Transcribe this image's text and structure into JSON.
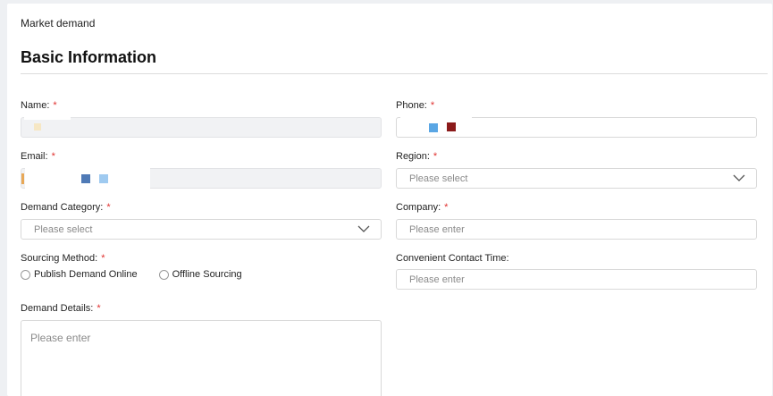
{
  "breadcrumb": "Market demand",
  "section_title": "Basic Information",
  "required_mark": "*",
  "form": {
    "name_label": "Name:",
    "phone_label": "Phone:",
    "email_label": "Email:",
    "region_label": "Region:",
    "region_placeholder": "Please select",
    "demand_category_label": "Demand Category:",
    "demand_category_placeholder": "Please select",
    "company_label": "Company:",
    "company_placeholder": "Please enter",
    "sourcing_method_label": "Sourcing Method:",
    "sourcing_options": [
      "Publish Demand Online",
      "Offline Sourcing"
    ],
    "contact_time_label": "Convenient Contact Time:",
    "contact_time_placeholder": "Please enter",
    "demand_details_label": "Demand Details:",
    "demand_details_placeholder": "Please enter"
  },
  "colors": {
    "required": "#e0312f",
    "disabled_bg": "#f1f2f4",
    "border": "#d9d9d9"
  },
  "icons": {
    "dropdown": "chevron-down-icon"
  }
}
